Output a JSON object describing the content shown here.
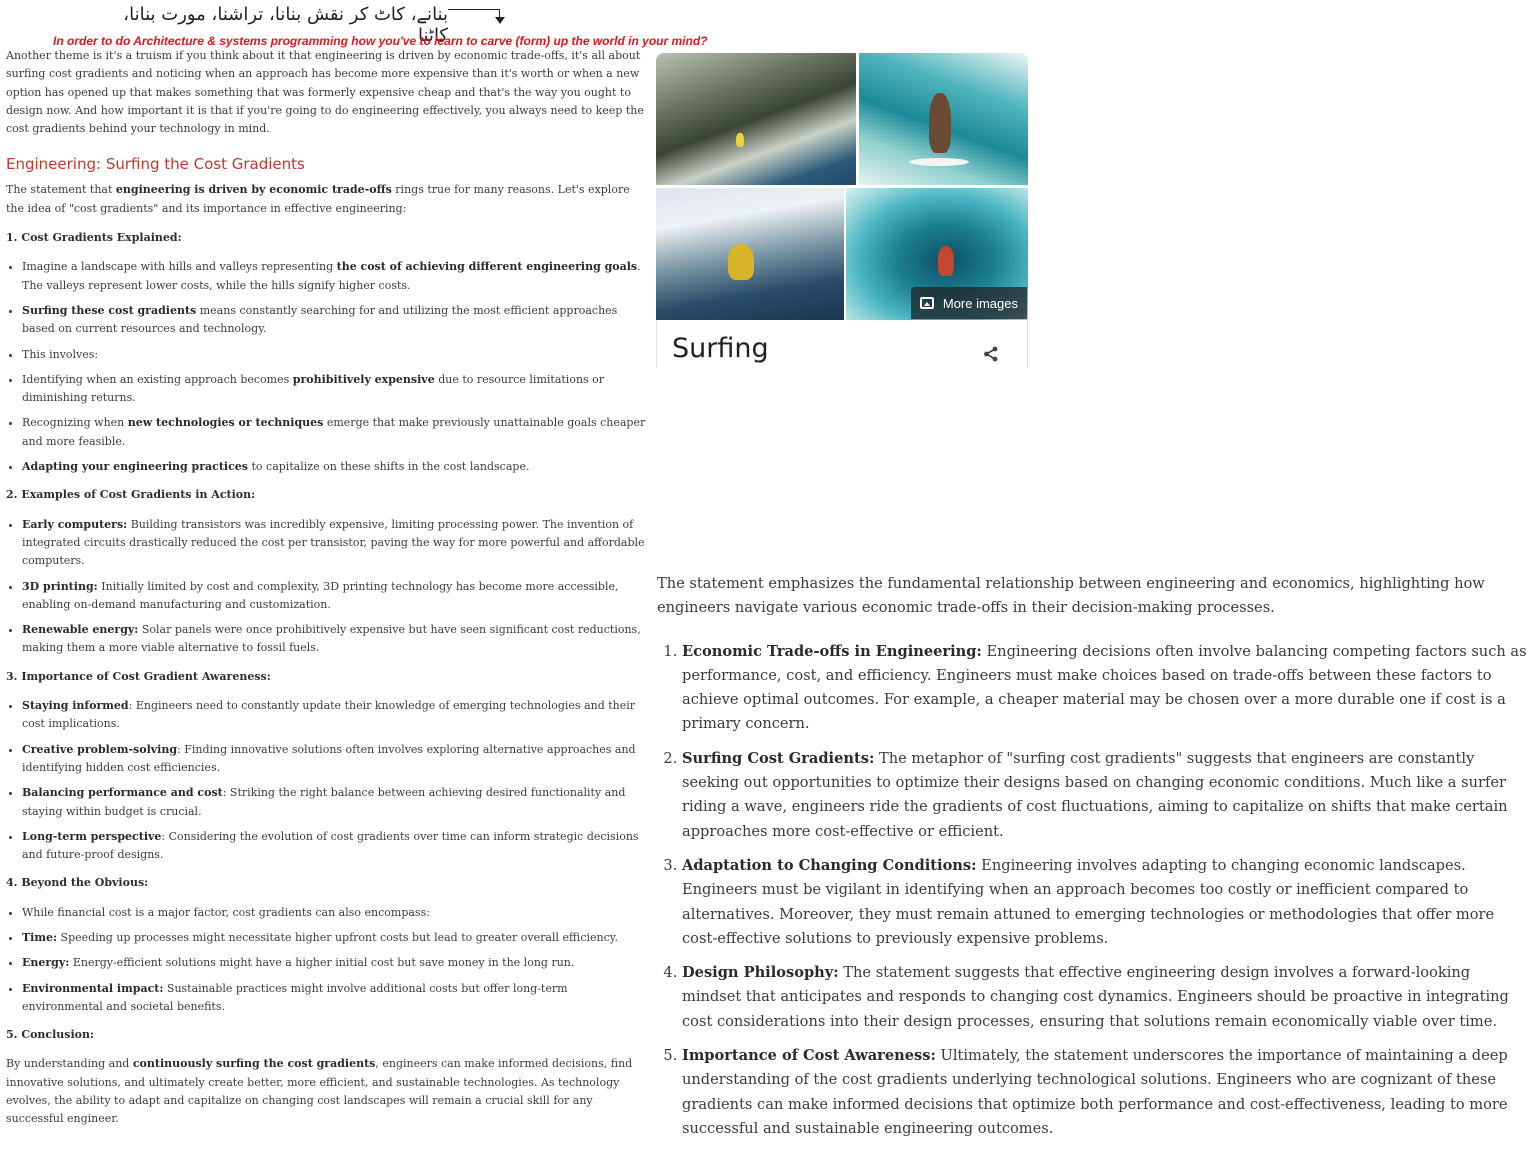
{
  "header": {
    "urdu_text": "بنانے، کاٹ کر نقش بنانا، تراشنا، مورت بنانا، کاٹنا",
    "tagline": "In order to do Architecture & systems programming how you've to learn to carve (form) up the world in your mind?"
  },
  "left": {
    "intro": "Another theme is it's a truism if you think about it that engineering is driven by economic trade-offs, it's all about surfing cost gradients and noticing when an approach has become more expensive than it's worth or when a new option has opened up that makes something that was formerly expensive cheap and that's the way you ought to design now. And how important it is that if you're going to do engineering effectively, you always need to keep the cost gradients behind your technology in mind.",
    "heading": "Engineering: Surfing the Cost Gradients",
    "lead": {
      "a": "The statement that ",
      "b": "engineering is driven by economic trade-offs",
      "c": " rings true for many reasons. Let's explore the idea of \"cost gradients\" and its importance in effective engineering:"
    },
    "s1": {
      "title": "1. Cost Gradients Explained:",
      "i1a": "Imagine a landscape with hills and valleys representing ",
      "i1b": "the cost of achieving different engineering goals",
      "i1c": ". The valleys represent lower costs, while the hills signify higher costs.",
      "i2b": "Surfing these cost gradients",
      "i2c": " means constantly searching for and utilizing the most efficient approaches based on current resources and technology.",
      "i3": "This involves:",
      "i4a": "Identifying when an existing approach becomes ",
      "i4b": "prohibitively expensive",
      "i4c": " due to resource limitations or diminishing returns.",
      "i5a": "Recognizing when ",
      "i5b": "new technologies or techniques",
      "i5c": " emerge that make previously unattainable goals cheaper and more feasible.",
      "i6b": "Adapting your engineering practices",
      "i6c": " to capitalize on these shifts in the cost landscape."
    },
    "s2": {
      "title": "2. Examples of Cost Gradients in Action:",
      "i1b": "Early computers:",
      "i1c": " Building transistors was incredibly expensive, limiting processing power. The invention of integrated circuits drastically reduced the cost per transistor, paving the way for more powerful and affordable computers.",
      "i2b": "3D printing:",
      "i2c": " Initially limited by cost and complexity, 3D printing technology has become more accessible, enabling on-demand manufacturing and customization.",
      "i3b": "Renewable energy:",
      "i3c": " Solar panels were once prohibitively expensive but have seen significant cost reductions, making them a more viable alternative to fossil fuels."
    },
    "s3": {
      "title": "3. Importance of Cost Gradient Awareness:",
      "i1b": "Staying informed",
      "i1c": ": Engineers need to constantly update their knowledge of emerging technologies and their cost implications.",
      "i2b": "Creative problem-solving",
      "i2c": ": Finding innovative solutions often involves exploring alternative approaches and identifying hidden cost efficiencies.",
      "i3b": "Balancing performance and cost",
      "i3c": ": Striking the right balance between achieving desired functionality and staying within budget is crucial.",
      "i4b": "Long-term perspective",
      "i4c": ": Considering the evolution of cost gradients over time can inform strategic decisions and future-proof designs."
    },
    "s4": {
      "title": "4. Beyond the Obvious:",
      "i1": "While financial cost is a major factor, cost gradients can also encompass:",
      "i2b": "Time:",
      "i2c": " Speeding up processes might necessitate higher upfront costs but lead to greater overall efficiency.",
      "i3b": "Energy:",
      "i3c": " Energy-efficient solutions might have a higher initial cost but save money in the long run.",
      "i4b": "Environmental impact:",
      "i4c": " Sustainable practices might involve additional costs but offer long-term environmental and societal benefits."
    },
    "s5": {
      "title": "5. Conclusion:",
      "a": "By understanding and ",
      "b": "continuously surfing the cost gradients",
      "c": ", engineers can make informed decisions, find innovative solutions, and ultimately create better, more efficient, and sustainable technologies. As technology evolves, the ability to adapt and capitalize on changing cost landscapes will remain a crucial skill for any successful engineer."
    }
  },
  "panel": {
    "title": "Surfing",
    "more_images": "More images",
    "icons": [
      "image-icon",
      "share-icon"
    ]
  },
  "right": {
    "intro": "The statement emphasizes the fundamental relationship between engineering and economics, highlighting how engineers navigate various economic trade-offs in their decision-making processes.",
    "items": [
      {
        "b": "Economic Trade-offs in Engineering:",
        "c": " Engineering decisions often involve balancing competing factors such as performance, cost, and efficiency. Engineers must make choices based on trade-offs between these factors to achieve optimal outcomes. For example, a cheaper material may be chosen over a more durable one if cost is a primary concern."
      },
      {
        "b": "Surfing Cost Gradients:",
        "c": " The metaphor of \"surfing cost gradients\" suggests that engineers are constantly seeking out opportunities to optimize their designs based on changing economic conditions. Much like a surfer riding a wave, engineers ride the gradients of cost fluctuations, aiming to capitalize on shifts that make certain approaches more cost-effective or efficient."
      },
      {
        "b": "Adaptation to Changing Conditions:",
        "c": " Engineering involves adapting to changing economic landscapes. Engineers must be vigilant in identifying when an approach becomes too costly or inefficient compared to alternatives. Moreover, they must remain attuned to emerging technologies or methodologies that offer more cost-effective solutions to previously expensive problems."
      },
      {
        "b": "Design Philosophy:",
        "c": " The statement suggests that effective engineering design involves a forward-looking mindset that anticipates and responds to changing cost dynamics. Engineers should be proactive in integrating cost considerations into their design processes, ensuring that solutions remain economically viable over time."
      },
      {
        "b": "Importance of Cost Awareness:",
        "c": " Ultimately, the statement underscores the importance of maintaining a deep understanding of the cost gradients underlying technological solutions. Engineers who are cognizant of these gradients can make informed decisions that optimize both performance and cost-effectiveness, leading to more successful and sustainable engineering outcomes."
      }
    ]
  }
}
